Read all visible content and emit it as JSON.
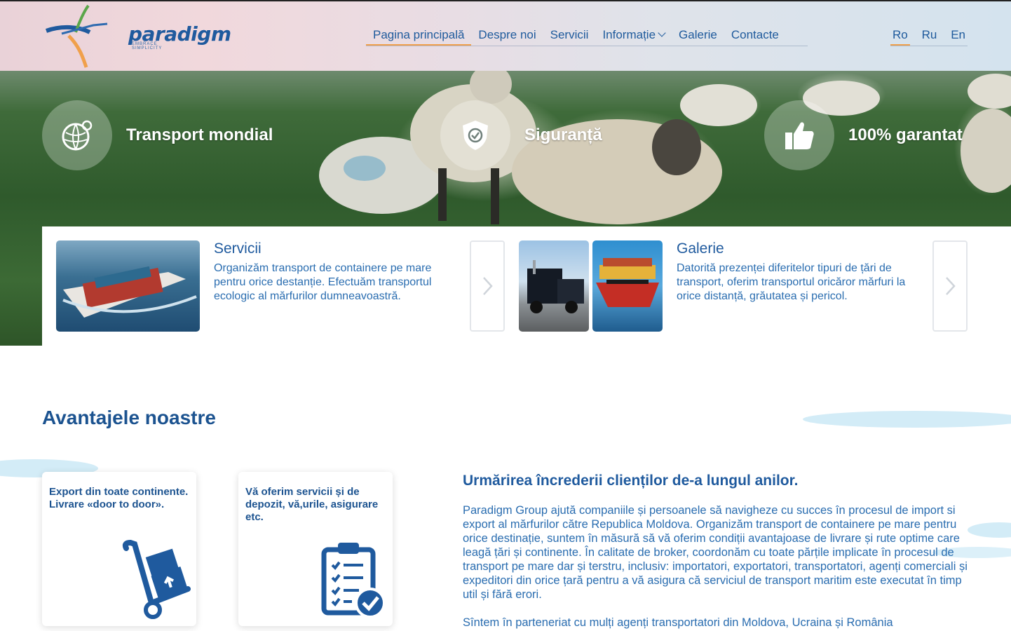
{
  "brand": {
    "name": "paradigm",
    "tagline": "EMBRACE SIMPLICITY"
  },
  "nav": {
    "items": [
      {
        "label": "Pagina principală",
        "active": true
      },
      {
        "label": "Despre noi"
      },
      {
        "label": "Servicii"
      },
      {
        "label": "Informație",
        "has_dropdown": true
      },
      {
        "label": "Galerie"
      },
      {
        "label": "Contacte"
      }
    ]
  },
  "languages": [
    {
      "label": "Ro",
      "active": true
    },
    {
      "label": "Ru"
    },
    {
      "label": "En"
    }
  ],
  "features": [
    {
      "label": "Transport mondial",
      "icon": "globe-icon"
    },
    {
      "label": "Siguranță",
      "icon": "shield-icon"
    },
    {
      "label": "100% garantat",
      "icon": "thumbs-up-icon"
    }
  ],
  "cards": {
    "services": {
      "title": "Servicii",
      "text": "Organizăm transport de containere pe mare pentru orice destanție. Efectuăm transportul ecologic al mărfurilor dumneavoastră."
    },
    "gallery": {
      "title": "Galerie",
      "text": "Datorită prezenței diferitelor tipuri de țări de transport, oferim transportul oricăror mărfuri la orice distanță, grăutatea și pericol."
    }
  },
  "advantages": {
    "title": "Avantajele noastre",
    "cards": [
      {
        "text": "Export din toate continente. Livrare «door to door».",
        "icon": "hand-truck-icon"
      },
      {
        "text": "Vă oferim servicii și de depozit, vă,urile, asigurare etc.",
        "icon": "clipboard-check-icon"
      }
    ],
    "info_title": "Urmărirea încrederii clienților de-a lungul anilor.",
    "paragraphs": [
      "Paradigm Group ajută companiile și persoanele să navigheze cu succes în procesul de import si export al mărfurilor către Republica Moldova. Organizăm transport de containere pe mare pentru orice destinație, suntem în măsură să vă oferim condiții avantajoase de livrare și rute optime care leagă țări și continente. În calitate de broker, coordonăm cu toate părțile implicate în procesul de transport pe mare dar și terstru, inclusiv: importatori, exportatori, transportatori, agenți comerciali și expeditori din orice țară pentru a vă asigura că serviciul de transport maritim este executat în timp util și fără erori.",
      "Sîntem în parteneriat cu mulți agenți transportatori din Moldova, Ucraina și România"
    ]
  },
  "colors": {
    "primary": "#1f5a9e",
    "accent": "#f0a04b",
    "text": "#2a6db0"
  }
}
